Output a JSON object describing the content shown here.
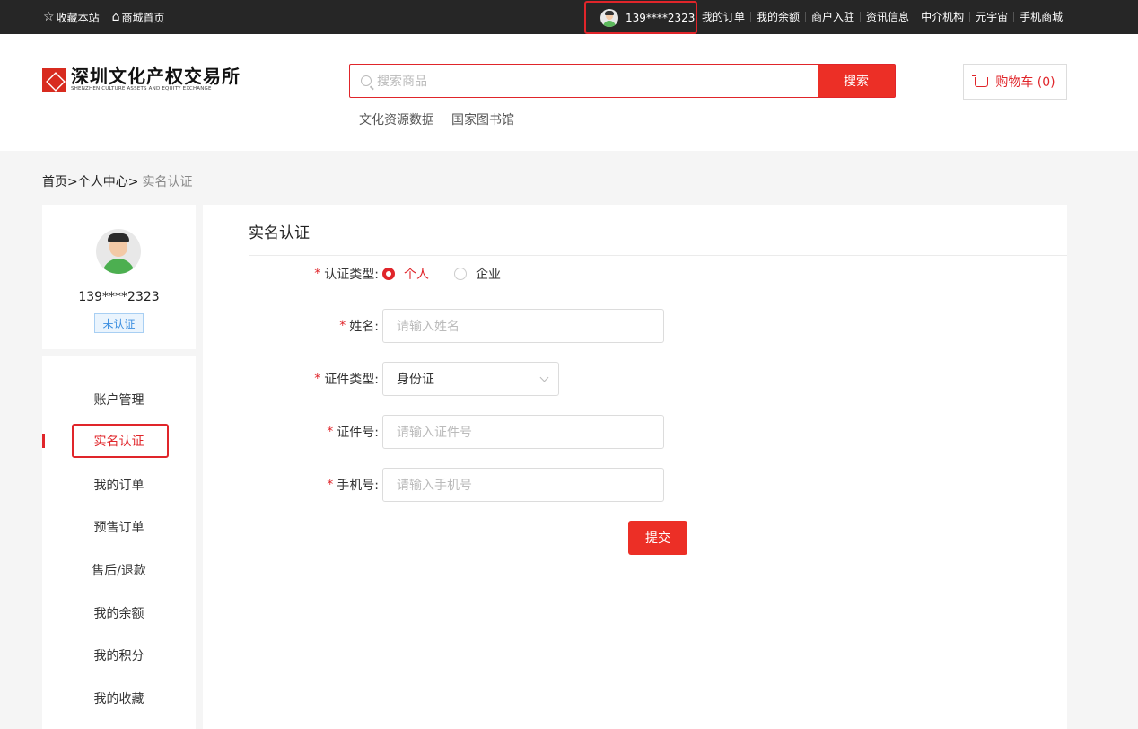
{
  "topbar": {
    "favorite_label": "收藏本站",
    "home_label": "商城首页",
    "user_phone": "139****2323",
    "links": [
      "我的订单",
      "我的余额",
      "商户入驻",
      "资讯信息",
      "中介机构",
      "元宇宙",
      "手机商城"
    ]
  },
  "header": {
    "logo_cn": "深圳文化产权交易所",
    "logo_en": "SHENZHEN CULTURE ASSETS AND EQUITY EXCHANGE",
    "search_placeholder": "搜索商品",
    "search_button": "搜索",
    "hot_links": [
      "文化资源数据",
      "国家图书馆"
    ],
    "cart_label": "购物车 (0)"
  },
  "breadcrumb": {
    "home": "首页>",
    "center": "个人中心>",
    "current": "实名认证"
  },
  "profile": {
    "phone": "139****2323",
    "status_badge": "未认证"
  },
  "menu": {
    "items": [
      "账户管理",
      "实名认证",
      "我的订单",
      "预售订单",
      "售后/退款",
      "我的余额",
      "我的积分",
      "我的收藏"
    ],
    "active": "实名认证"
  },
  "form": {
    "title": "实名认证",
    "cert_type_label": "认证类型:",
    "cert_type_options": [
      "个人",
      "企业"
    ],
    "cert_type_selected": "个人",
    "name_label": "姓名:",
    "name_placeholder": "请输入姓名",
    "id_type_label": "证件类型:",
    "id_type_value": "身份证",
    "id_number_label": "证件号:",
    "id_number_placeholder": "请输入证件号",
    "mobile_label": "手机号:",
    "mobile_placeholder": "请输入手机号",
    "submit_label": "提交"
  },
  "colors": {
    "accent": "#ec2f26",
    "topbar_bg": "#262626",
    "badge_blue": "#3d8fe0"
  }
}
